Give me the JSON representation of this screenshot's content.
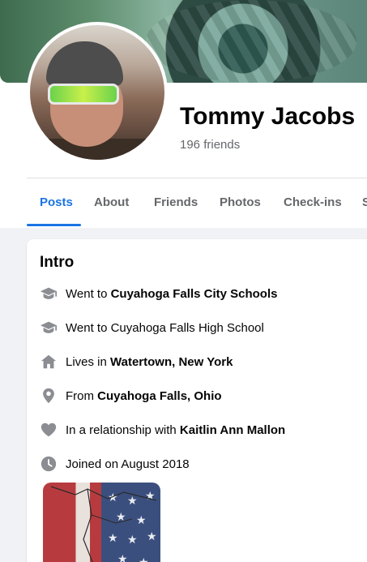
{
  "profile": {
    "name": "Tommy Jacobs",
    "friends": "196 friends"
  },
  "tabs": [
    {
      "label": "Posts",
      "active": true
    },
    {
      "label": "About"
    },
    {
      "label": "Friends"
    },
    {
      "label": "Photos"
    },
    {
      "label": "Check-ins"
    },
    {
      "label": "S"
    }
  ],
  "intro": {
    "title": "Intro",
    "items": [
      {
        "icon": "graduation-cap-icon",
        "prefix": "Went to ",
        "bold": "Cuyahoga Falls City Schools"
      },
      {
        "icon": "graduation-cap-icon",
        "prefix": "Went to Cuyahoga Falls High School",
        "bold": ""
      },
      {
        "icon": "house-icon",
        "prefix": "Lives in ",
        "bold": "Watertown, New York"
      },
      {
        "icon": "location-pin-icon",
        "prefix": "From ",
        "bold": "Cuyahoga Falls, Ohio"
      },
      {
        "icon": "heart-icon",
        "prefix": "In a relationship with ",
        "bold": "Kaitlin Ann Mallon"
      },
      {
        "icon": "clock-icon",
        "prefix": "Joined on August 2018",
        "bold": ""
      }
    ]
  },
  "colors": {
    "accent": "#1b74e4",
    "text": "#050505",
    "muted": "#65676b",
    "background": "#f0f2f5"
  }
}
